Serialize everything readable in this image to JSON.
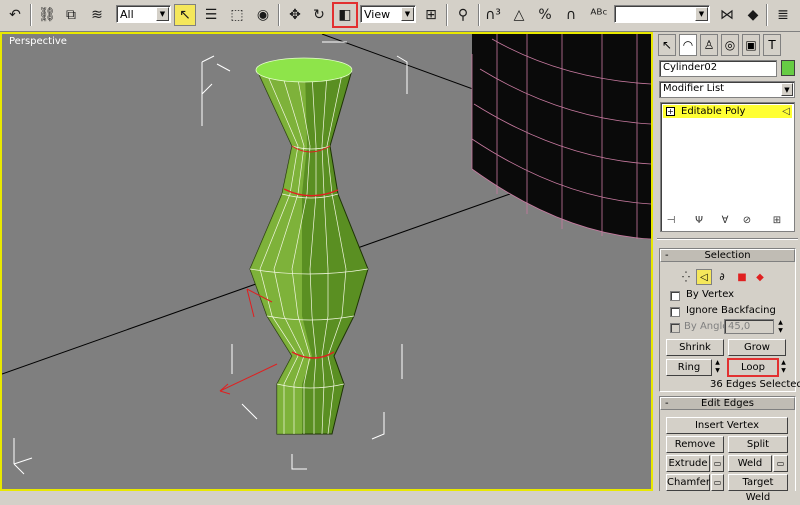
{
  "toolbar": {
    "selection_filter": "All",
    "reference_coord": "View",
    "named_selection": ""
  },
  "viewport": {
    "label": "Perspective"
  },
  "panel": {
    "object_name": "Cylinder02",
    "object_color": "#66cc44",
    "modifier_list": "Modifier List",
    "stack_item": "Editable Poly",
    "selection": {
      "title": "Selection",
      "by_vertex": "By Vertex",
      "ignore_backfacing": "Ignore Backfacing",
      "by_angle": "By Angle:",
      "angle_value": "45,0",
      "shrink": "Shrink",
      "grow": "Grow",
      "ring": "Ring",
      "loop": "Loop",
      "status": "36 Edges Selected"
    },
    "edit_edges": {
      "title": "Edit Edges",
      "insert_vertex": "Insert Vertex",
      "remove": "Remove",
      "split": "Split",
      "extrude": "Extrude",
      "weld": "Weld",
      "chamfer": "Chamfer",
      "target_weld": "Target Weld"
    }
  },
  "colors": {
    "viewport_bg": "#7f7f7f",
    "active_border": "#e8e800",
    "object_green": "#6fa82c",
    "selected_edge": "#e02020",
    "highlight": "#ffff33"
  }
}
